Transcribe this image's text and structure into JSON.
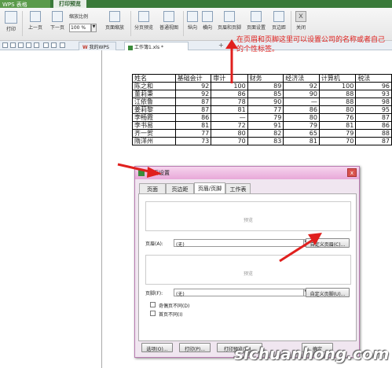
{
  "app": {
    "name": "WPS 表格",
    "active_tab": "打印预览"
  },
  "toolbar": {
    "print": "打印",
    "prev_page": "上一页",
    "next_page": "下一页",
    "zoom_label": "缩放比例",
    "zoom_value": "100 %",
    "page_zoom": "页面缩放",
    "page_break_preview": "分页预览",
    "normal_view": "普通视图",
    "portrait": "纵向",
    "landscape": "横向",
    "header_footer": "页眉和页脚",
    "page_setup": "页面设置",
    "margins": "页边距",
    "close": "关闭"
  },
  "tabs": {
    "home": "我的WPS",
    "file": "工作簿1.xls *",
    "plus": "+"
  },
  "annotation": "在页眉和页脚这里可以设置公司的名称或者自己的个性标签。",
  "sheet": {
    "headers": [
      "姓名",
      "基础会计",
      "审计",
      "财务",
      "经济法",
      "计算机",
      "税法"
    ],
    "rows": [
      [
        "陈之和",
        "92",
        "100",
        "89",
        "92",
        "100",
        "96"
      ],
      [
        "董莉秉",
        "92",
        "86",
        "85",
        "90",
        "88",
        "93"
      ],
      [
        "江依鲁",
        "87",
        "78",
        "90",
        "—",
        "88",
        "98"
      ],
      [
        "姜莉黎",
        "87",
        "81",
        "77",
        "86",
        "80",
        "95"
      ],
      [
        "李畅霞",
        "86",
        "—",
        "79",
        "80",
        "76",
        "87"
      ],
      [
        "李书易",
        "81",
        "72",
        "91",
        "79",
        "81",
        "86"
      ],
      [
        "齐一贺",
        "77",
        "80",
        "82",
        "65",
        "79",
        "88"
      ],
      [
        "隋洋州",
        "73",
        "70",
        "83",
        "81",
        "70",
        "87"
      ]
    ]
  },
  "dialog": {
    "title": "页面设置",
    "close_glyph": "x",
    "tabs": [
      "页面",
      "页边距",
      "页眉/页脚",
      "工作表"
    ],
    "preview_label": "预览",
    "header_label": "页眉(A):",
    "header_value": "(无)",
    "custom_header": "自定义页眉(C)...",
    "footer_label": "页脚(F):",
    "footer_value": "(无)",
    "custom_footer": "自定义页脚(U)...",
    "odd_even": "奇偶页不同(D)",
    "first_page": "首页不同(I)",
    "options": "选项(O)...",
    "print": "打印(P)...",
    "print_preview": "打印预览(W)...",
    "ok": "确定",
    "dropdown_glyph": "▼"
  },
  "watermark": "sichuanhong.com",
  "colors": {
    "accent_red": "#e0201e",
    "dialog_border": "#b87bb0"
  }
}
